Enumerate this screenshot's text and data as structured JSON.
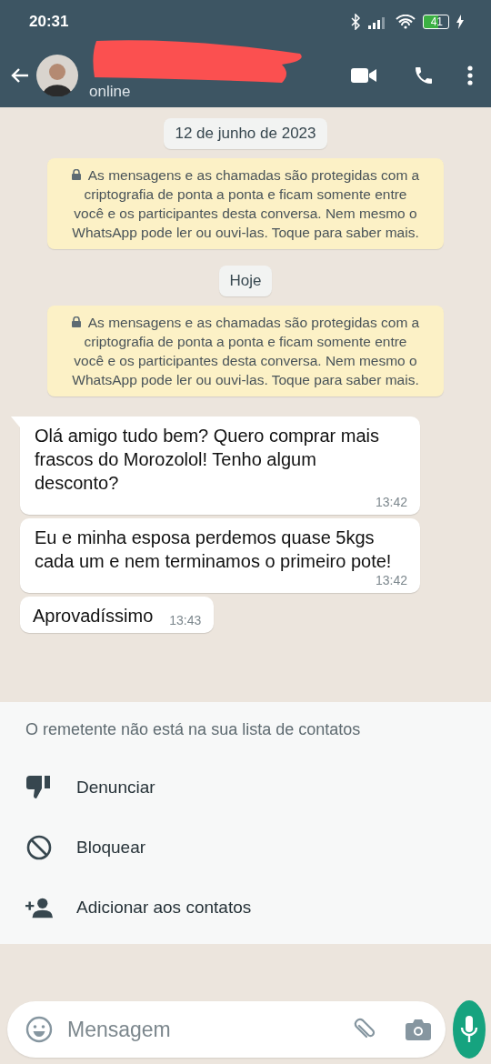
{
  "status_bar": {
    "time": "20:31",
    "battery": "41"
  },
  "header": {
    "status": "online"
  },
  "chat": [
    {
      "kind": "date",
      "text": "12 de junho de 2023"
    },
    {
      "kind": "notice",
      "text": "As mensagens e as chamadas são protegidas com a criptografia de ponta a ponta e ficam somente entre você e os participantes desta conversa. Nem mesmo o WhatsApp pode ler ou ouvi-las. Toque para saber mais."
    },
    {
      "kind": "date",
      "text": "Hoje"
    },
    {
      "kind": "notice",
      "text": "As mensagens e as chamadas são protegidas com a criptografia de ponta a ponta e ficam somente entre você e os participantes desta conversa. Nem mesmo o WhatsApp pode ler ou ouvi-las. Toque para saber mais."
    },
    {
      "kind": "message",
      "text": "Olá amigo tudo bem? Quero comprar mais frascos do Morozolol! Tenho algum desconto?",
      "time": "13:42",
      "tail": true
    },
    {
      "kind": "message",
      "text": "Eu e minha esposa perdemos quase 5kgs cada um e nem terminamos o primeiro pote!",
      "time": "13:42",
      "tail": false
    },
    {
      "kind": "message",
      "text": "Aprovadíssimo",
      "time": "13:43",
      "tail": false
    }
  ],
  "unknown_sender": {
    "text": "O remetente não está na sua lista de contatos",
    "actions": [
      "Denunciar",
      "Bloquear",
      "Adicionar aos contatos"
    ]
  },
  "composer": {
    "placeholder": "Mensagem"
  }
}
